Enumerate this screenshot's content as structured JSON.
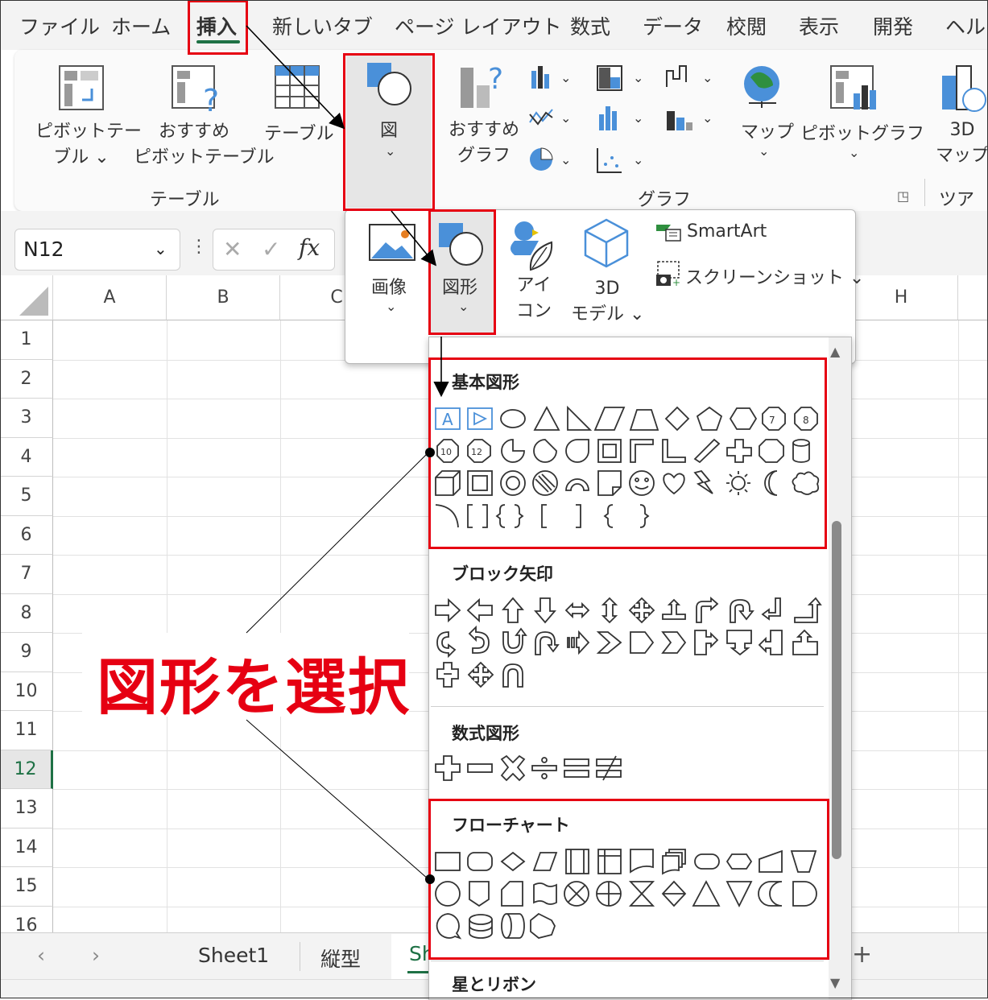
{
  "menu": {
    "items": [
      "ファイル",
      "ホーム",
      "挿入",
      "新しいタブ",
      "ページ レイアウト",
      "数式",
      "データ",
      "校閲",
      "表示",
      "開発",
      "ヘルプ"
    ]
  },
  "ribbon": {
    "pivot_table": [
      "ピボットテー",
      "ブル ⌄"
    ],
    "recommended_pivot": [
      "おすすめ",
      "ピボットテーブル"
    ],
    "table": "テーブル",
    "illustrations": "図",
    "recommended_chart": [
      "おすすめ",
      "グラフ"
    ],
    "map": "マップ",
    "pivot_chart": "ピボットグラフ",
    "map3d": [
      "3D",
      "マップ"
    ],
    "group_table": "テーブル",
    "group_chart": "グラフ",
    "group_tour": "ツアー"
  },
  "formula_bar": {
    "name_box": "N12",
    "cancel_glyph": "✕",
    "enter_glyph": "✓",
    "fx_glyph": "fx"
  },
  "sheet": {
    "columns": [
      "A",
      "B",
      "C",
      "H"
    ],
    "rows": [
      "1",
      "2",
      "3",
      "4",
      "5",
      "6",
      "7",
      "8",
      "9",
      "10",
      "11",
      "12",
      "13",
      "14",
      "15",
      "16"
    ],
    "selected_row": "12"
  },
  "tabs": {
    "items": [
      "Sheet1",
      "縦型",
      "Sh"
    ],
    "add": "+"
  },
  "illustrations_menu": {
    "image": "画像",
    "shapes": "図形",
    "icons": [
      "アイ",
      "コン"
    ],
    "model3d": [
      "3D",
      "モデル ⌄"
    ],
    "smartart": "SmartArt",
    "screenshot": "スクリーンショット ⌄"
  },
  "shapes_gallery": {
    "sections": [
      "基本図形",
      "ブロック矢印",
      "数式図形",
      "フローチャート",
      "星とリボン"
    ]
  },
  "callout": "図形を選択",
  "colors": {
    "accent_red": "#e60012",
    "excel_green": "#1e7145",
    "icon_blue": "#4a90d9"
  }
}
